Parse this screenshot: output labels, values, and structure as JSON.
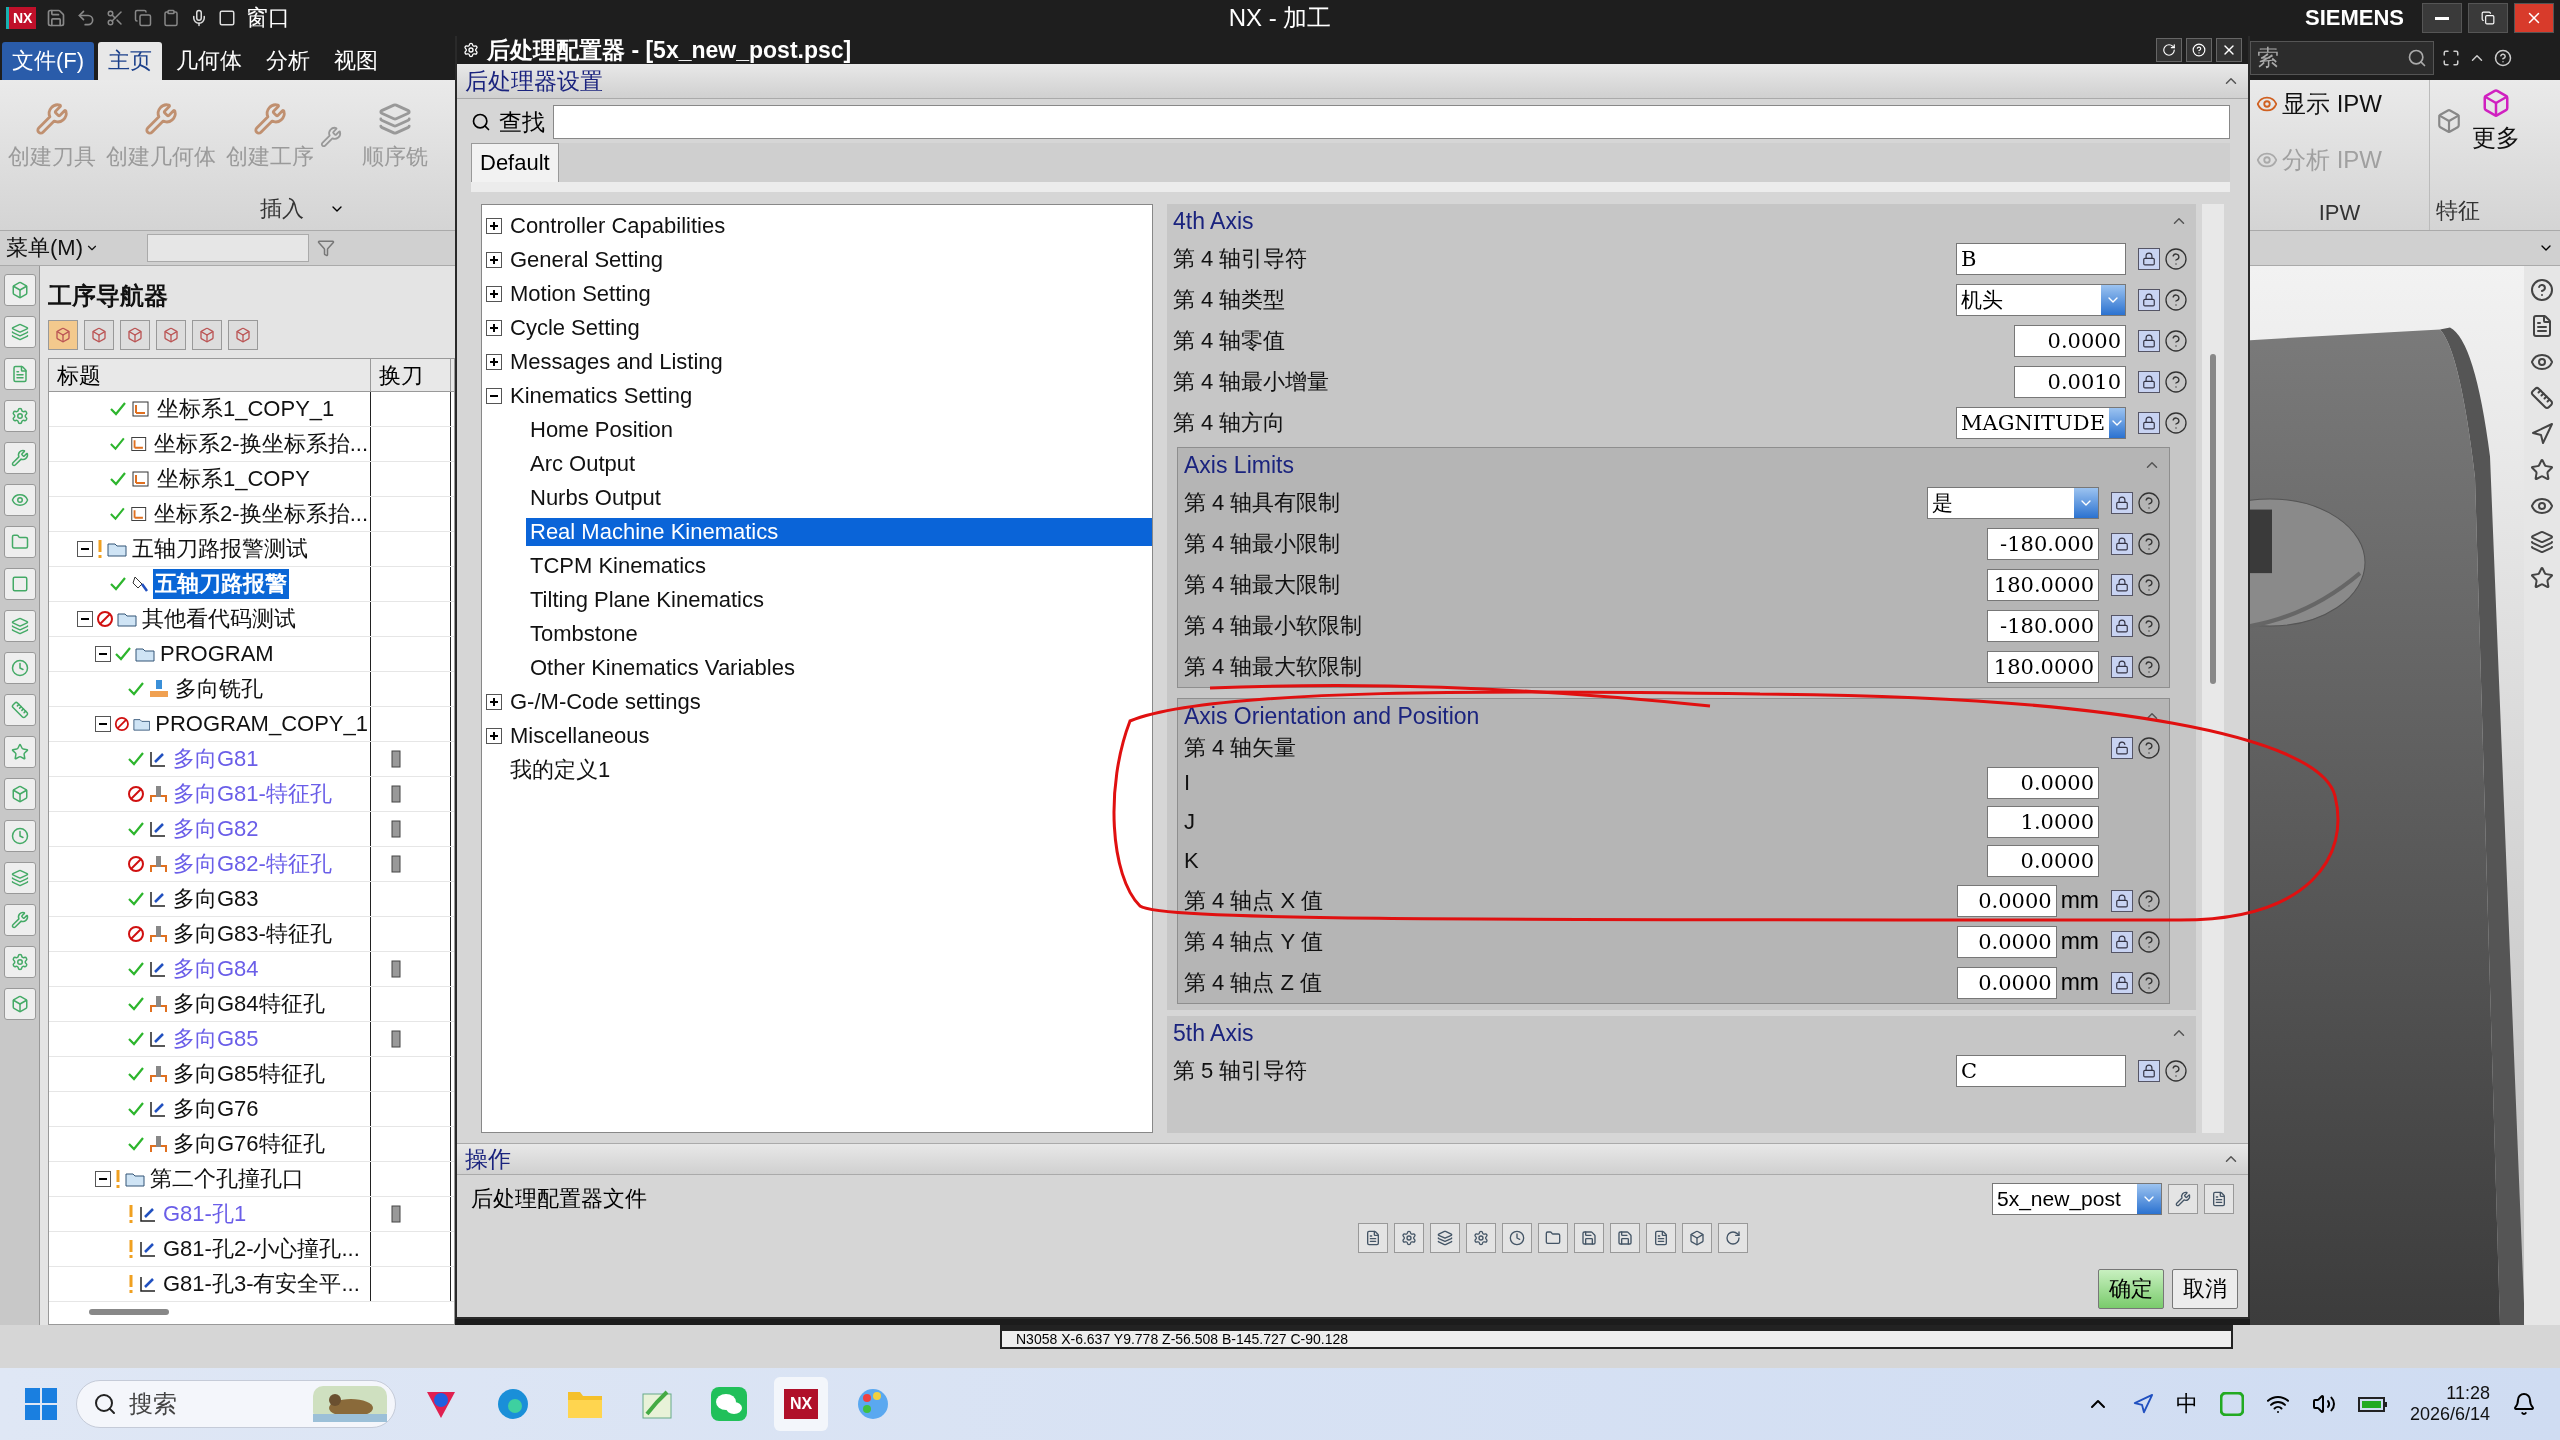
{
  "app_bar": {
    "logo_text": "NX",
    "quick_menu": "窗口",
    "title": "NX - 加工",
    "brand": "SIEMENS",
    "menu_tabs": [
      {
        "label": "文件(F)",
        "kind": "file",
        "selected": false
      },
      {
        "label": "主页",
        "kind": "tab",
        "selected": true
      },
      {
        "label": "几何体",
        "kind": "tab",
        "selected": false
      },
      {
        "label": "分析",
        "kind": "tab",
        "selected": false
      },
      {
        "label": "视图",
        "kind": "tab",
        "selected": false
      }
    ]
  },
  "ribbon": {
    "insert_buttons": [
      "创建刀具",
      "创建几何体",
      "创建工序"
    ],
    "sequence_button": "顺序铣",
    "insert_group": "插入",
    "search_placeholder": "索",
    "ipw_buttons": [
      {
        "label": "显示 IPW",
        "disabled": false
      },
      {
        "label": "分析 IPW",
        "disabled": true
      }
    ],
    "ipw_group": "IPW",
    "more": "更多",
    "feature_group": "特征"
  },
  "menu_bar": {
    "label": "菜单(M)"
  },
  "navigator": {
    "title": "工序导航器",
    "columns": [
      "标题",
      "换刀"
    ],
    "continued_rows": [
      {
        "label": "坐标系1_COPY_1",
        "error": false,
        "warning": false,
        "kind": "csys",
        "selected": false
      },
      {
        "label": "坐标系2-换坐标系抬...",
        "error": false,
        "warning": false,
        "kind": "csys",
        "selected": false
      },
      {
        "label": "坐标系1_COPY",
        "error": false,
        "warning": false,
        "kind": "csys",
        "selected": false
      },
      {
        "label": "坐标系2-换坐标系抬...",
        "error": false,
        "warning": false,
        "kind": "csys",
        "selected": false
      }
    ],
    "rows": [
      {
        "label": "五轴刀路报警测试",
        "error": false,
        "warning": true,
        "kind": "folder",
        "expanded": true,
        "selected": false,
        "children": [
          {
            "label": "五轴刀路报警",
            "error": false,
            "warning": false,
            "kind": "tool_op",
            "selected": true
          }
        ]
      },
      {
        "label": "其他看代码测试",
        "error": true,
        "warning": false,
        "kind": "folder",
        "expanded": true,
        "selected": false,
        "children": [
          {
            "label": "PROGRAM",
            "error": false,
            "warning": false,
            "kind": "folder",
            "expanded": true,
            "selected": false,
            "children": [
              {
                "label": "多向铣孔",
                "error": false,
                "warning": false,
                "kind": "mill",
                "selected": false
              }
            ]
          },
          {
            "label": "PROGRAM_COPY_1",
            "error": true,
            "warning": false,
            "kind": "folder",
            "expanded": true,
            "selected": false,
            "children": [
              {
                "label": "多向G81",
                "error": false,
                "warning": false,
                "kind": "op",
                "link": true,
                "tool": true,
                "selected": false
              },
              {
                "label": "多向G81-特征孔",
                "error": true,
                "warning": false,
                "kind": "feature",
                "link": true,
                "tool": true,
                "selected": false
              },
              {
                "label": "多向G82",
                "error": false,
                "warning": false,
                "kind": "op",
                "link": true,
                "tool": true,
                "selected": false
              },
              {
                "label": "多向G82-特征孔",
                "error": true,
                "warning": false,
                "kind": "feature",
                "link": true,
                "tool": true,
                "selected": false
              },
              {
                "label": "多向G83",
                "error": false,
                "warning": false,
                "kind": "op",
                "selected": false
              },
              {
                "label": "多向G83-特征孔",
                "error": true,
                "warning": false,
                "kind": "feature",
                "selected": false
              },
              {
                "label": "多向G84",
                "error": false,
                "warning": false,
                "kind": "op",
                "link": true,
                "tool": true,
                "selected": false
              },
              {
                "label": "多向G84特征孔",
                "error": false,
                "warning": false,
                "kind": "feature",
                "selected": false
              },
              {
                "label": "多向G85",
                "error": false,
                "warning": false,
                "kind": "op",
                "link": true,
                "tool": true,
                "selected": false
              },
              {
                "label": "多向G85特征孔",
                "error": false,
                "warning": false,
                "kind": "feature",
                "selected": false
              },
              {
                "label": "多向G76",
                "error": false,
                "warning": false,
                "kind": "op",
                "selected": false
              },
              {
                "label": "多向G76特征孔",
                "error": false,
                "warning": false,
                "kind": "feature",
                "selected": false
              }
            ]
          },
          {
            "label": "第二个孔撞孔口",
            "error": false,
            "warning": true,
            "kind": "folder",
            "expanded": true,
            "selected": false,
            "children": [
              {
                "label": "G81-孔1",
                "error": false,
                "warning": true,
                "kind": "op",
                "link": true,
                "tool": true,
                "selected": false
              },
              {
                "label": "G81-孔2-小心撞孔...",
                "error": false,
                "warning": true,
                "kind": "op",
                "selected": false
              },
              {
                "label": "G81-孔3-有安全平...",
                "error": false,
                "warning": true,
                "kind": "op",
                "selected": false
              }
            ]
          }
        ]
      }
    ]
  },
  "dialog": {
    "title": "后处理配置器 - [5x_new_post.psc]",
    "header": "后处理器设置",
    "search_label": "查找",
    "tabs": [
      {
        "label": "Default",
        "selected": true
      }
    ],
    "tree": [
      {
        "label": "Controller Capabilities",
        "expanded": false,
        "selected": false
      },
      {
        "label": "General Setting",
        "expanded": false,
        "selected": false
      },
      {
        "label": "Motion Setting",
        "expanded": false,
        "selected": false
      },
      {
        "label": "Cycle Setting",
        "expanded": false,
        "selected": false
      },
      {
        "label": "Messages and Listing",
        "expanded": false,
        "selected": false
      },
      {
        "label": "Kinematics Setting",
        "expanded": true,
        "selected": false,
        "children": [
          {
            "label": "Home Position",
            "selected": false
          },
          {
            "label": "Arc Output",
            "selected": false
          },
          {
            "label": "Nurbs Output",
            "selected": false
          },
          {
            "label": "Real Machine Kinematics",
            "selected": true
          },
          {
            "label": "TCPM Kinematics",
            "selected": false
          },
          {
            "label": "Tilting Plane Kinematics",
            "selected": false
          },
          {
            "label": "Tombstone",
            "selected": false
          },
          {
            "label": "Other Kinematics Variables",
            "selected": false
          }
        ]
      },
      {
        "label": "G-/M-Code settings",
        "expanded": false,
        "selected": false
      },
      {
        "label": "Miscellaneous",
        "expanded": false,
        "selected": false
      },
      {
        "label": "我的定义1",
        "selected": false
      }
    ],
    "sections": [
      {
        "title": "4th Axis",
        "rows": [
          {
            "label": "第 4 轴引导符",
            "kind": "text",
            "value": "B",
            "locked": true
          },
          {
            "label": "第 4 轴类型",
            "kind": "dropdown",
            "value": "机头",
            "locked": true
          },
          {
            "label": "第 4 轴零值",
            "kind": "number",
            "value": "0.0000",
            "locked": true
          },
          {
            "label": "第 4 轴最小增量",
            "kind": "number",
            "value": "0.0010",
            "locked": true
          },
          {
            "label": "第 4 轴方向",
            "kind": "dropdown",
            "value": "MAGNITUDE",
            "locked": true
          }
        ],
        "subsections": [
          {
            "title": "Axis Limits",
            "rows": [
              {
                "label": "第 4 轴具有限制",
                "kind": "dropdown",
                "value": "是",
                "locked": true
              },
              {
                "label": "第 4 轴最小限制",
                "kind": "number",
                "value": "-180.000",
                "locked": true
              },
              {
                "label": "第 4 轴最大限制",
                "kind": "number",
                "value": "180.0000",
                "locked": true
              },
              {
                "label": "第 4 轴最小软限制",
                "kind": "number",
                "value": "-180.000",
                "locked": true
              },
              {
                "label": "第 4 轴最大软限制",
                "kind": "number",
                "value": "180.0000",
                "locked": true
              }
            ]
          },
          {
            "title": "Axis Orientation and Position",
            "rows": [
              {
                "label": "第 4 轴矢量",
                "kind": "vector",
                "locked": false
              },
              {
                "label": "I",
                "kind": "component",
                "value": "0.0000"
              },
              {
                "label": "J",
                "kind": "component",
                "value": "1.0000"
              },
              {
                "label": "K",
                "kind": "component",
                "value": "0.0000"
              },
              {
                "label": "第 4 轴点 X 值",
                "kind": "number",
                "value": "0.0000",
                "unit": "mm",
                "locked": true
              },
              {
                "label": "第 4 轴点 Y 值",
                "kind": "number",
                "value": "0.0000",
                "unit": "mm",
                "locked": true
              },
              {
                "label": "第 4 轴点 Z 值",
                "kind": "number",
                "value": "0.0000",
                "unit": "mm",
                "locked": true
              }
            ]
          }
        ]
      },
      {
        "title": "5th Axis",
        "rows": [
          {
            "label": "第 5 轴引导符",
            "kind": "text",
            "value": "C",
            "locked": true
          }
        ]
      }
    ],
    "operations": {
      "title": "操作",
      "file_label": "后处理配置器文件",
      "file_value": "5x_new_post"
    },
    "buttons": [
      {
        "label": "确定",
        "kind": "primary"
      },
      {
        "label": "取消",
        "kind": "normal"
      }
    ]
  },
  "status_line": "N3058 X-6.637 Y9.778 Z-56.508 B-145.727 C-90.128",
  "taskbar": {
    "search_placeholder": "搜索",
    "app_text": "NX",
    "ime": "中",
    "time": "11:28",
    "date": "2026/6/14"
  }
}
